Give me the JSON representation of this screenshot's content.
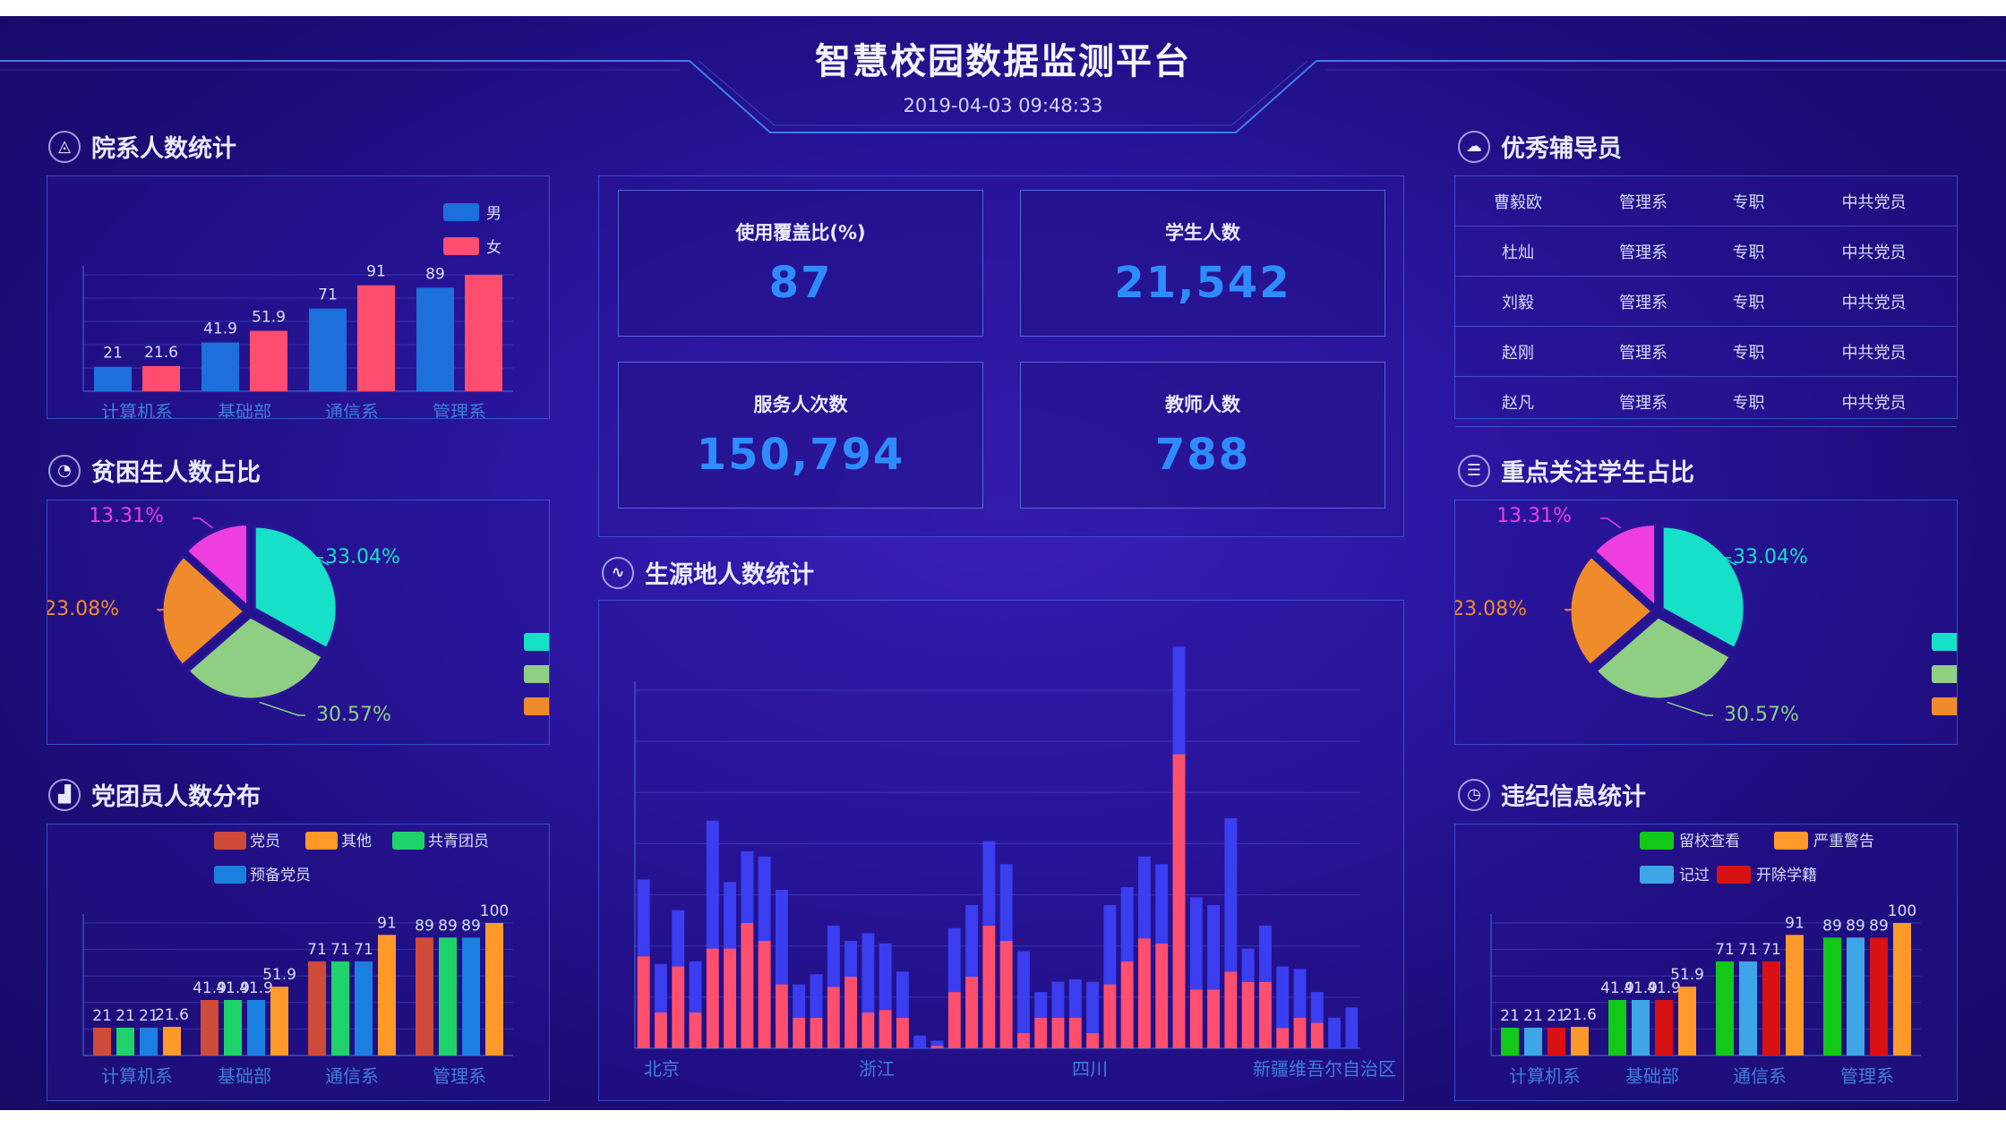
{
  "header": {
    "title": "智慧校园数据监测平台",
    "datetime": "2019-04-03 09:48:33"
  },
  "sections": {
    "dept_count": "院系人数统计",
    "poverty_ratio": "贫困生人数占比",
    "party_distribution": "党团员人数分布",
    "origin_stats": "生源地人数统计",
    "tutors": "优秀辅导员",
    "focus_ratio": "重点关注学生占比",
    "discipline": "违纪信息统计"
  },
  "stats": [
    {
      "label": "使用覆盖比(%)",
      "value": "87"
    },
    {
      "label": "学生人数",
      "value": "21,542"
    },
    {
      "label": "服务人次数",
      "value": "150,794"
    },
    {
      "label": "教师人数",
      "value": "788"
    }
  ],
  "tutors": [
    [
      "曹毅欧",
      "管理系",
      "专职",
      "中共党员"
    ],
    [
      "杜灿",
      "管理系",
      "专职",
      "中共党员"
    ],
    [
      "刘毅",
      "管理系",
      "专职",
      "中共党员"
    ],
    [
      "赵刚",
      "管理系",
      "专职",
      "中共党员"
    ],
    [
      "赵凡",
      "管理系",
      "专职",
      "中共党员"
    ]
  ],
  "colors": {
    "blue_bar": "#1d6fdc",
    "pink_bar": "#ff4d6d",
    "cyan": "#16e0c7",
    "green": "#8ecf84",
    "orange": "#f08b2c",
    "magenta": "#ee3ee0",
    "party_red": "#d04a3a",
    "party_orange": "#ff9a2a",
    "party_green": "#1fd36b",
    "party_blue": "#1a7fe0",
    "disc_green": "#12c91a",
    "disc_orange": "#ff9a2a",
    "disc_lightblue": "#3ea6e6",
    "disc_red": "#d81212",
    "origin_blue": "#3a3ef0",
    "origin_pink": "#ff4f6e"
  },
  "chart_data": [
    {
      "id": "dept_count",
      "type": "bar",
      "categories": [
        "计算机系",
        "基础部",
        "通信系",
        "管理系"
      ],
      "series": [
        {
          "name": "男",
          "values": [
            21,
            41.9,
            71,
            89
          ]
        },
        {
          "name": "女",
          "values": [
            21.6,
            51.9,
            91,
            100
          ]
        }
      ],
      "data_labels": [
        "21",
        "21.6",
        "41.9",
        "51.9",
        "71",
        "91",
        "89"
      ],
      "ylim": [
        0,
        100
      ]
    },
    {
      "id": "poverty_ratio",
      "type": "pie",
      "slices": [
        {
          "value": 33.04,
          "label": "33.04%"
        },
        {
          "value": 30.57,
          "label": "30.57%"
        },
        {
          "value": 23.08,
          "label": "23.08%"
        },
        {
          "value": 13.31,
          "label": "13.31%"
        }
      ]
    },
    {
      "id": "party_distribution",
      "type": "bar",
      "categories": [
        "计算机系",
        "基础部",
        "通信系",
        "管理系"
      ],
      "series": [
        {
          "name": "党员",
          "values": [
            21,
            41.9,
            71,
            89
          ]
        },
        {
          "name": "共青团员",
          "values": [
            21,
            41.9,
            71,
            89
          ]
        },
        {
          "name": "预备党员",
          "values": [
            21,
            41.9,
            71,
            89
          ]
        },
        {
          "name": "其他",
          "values": [
            21.6,
            51.9,
            91,
            100
          ]
        }
      ],
      "legend_order": [
        "党员",
        "其他",
        "共青团员",
        "预备党员"
      ],
      "data_labels": [
        [
          "21",
          "21",
          "21",
          "21.6"
        ],
        [
          "41.9",
          "41.9",
          "41.9",
          "51.9"
        ],
        [
          "71",
          "71",
          "71",
          "91"
        ],
        [
          "89",
          "89",
          "89",
          "100"
        ]
      ],
      "ylim": [
        0,
        100
      ]
    },
    {
      "id": "origin_stats",
      "type": "bar",
      "stacked": true,
      "x_ticks": [
        "北京",
        "浙江",
        "四川",
        "新疆维吾尔自治区"
      ],
      "series": [
        {
          "values": [
            30,
            19,
            22,
            20,
            50,
            26,
            28,
            33,
            37,
            13,
            17,
            24,
            14,
            31,
            26,
            18,
            5,
            2,
            25,
            28,
            33,
            30,
            32,
            10,
            14,
            15,
            20,
            31,
            29,
            32,
            31,
            42,
            36,
            33,
            60,
            13,
            22,
            24,
            19,
            12,
            12,
            16
          ]
        },
        {
          "values": [
            36,
            14,
            32,
            14,
            39,
            39,
            49,
            42,
            25,
            12,
            12,
            24,
            28,
            14,
            15,
            12,
            0,
            1,
            22,
            28,
            48,
            42,
            6,
            12,
            12,
            12,
            6,
            25,
            34,
            43,
            41,
            115,
            23,
            23,
            30,
            26,
            26,
            8,
            12,
            10
          ]
        }
      ],
      "ylim": [
        0,
        140
      ]
    },
    {
      "id": "focus_ratio",
      "type": "pie",
      "slices": [
        {
          "value": 33.04,
          "label": "33.04%"
        },
        {
          "value": 30.57,
          "label": "30.57%"
        },
        {
          "value": 23.08,
          "label": "23.08%"
        },
        {
          "value": 13.31,
          "label": "13.31%"
        }
      ]
    },
    {
      "id": "discipline",
      "type": "bar",
      "categories": [
        "计算机系",
        "基础部",
        "通信系",
        "管理系"
      ],
      "series": [
        {
          "name": "留校查看",
          "values": [
            21,
            41.9,
            71,
            89
          ]
        },
        {
          "name": "记过",
          "values": [
            21,
            41.9,
            71,
            89
          ]
        },
        {
          "name": "开除学籍",
          "values": [
            21,
            41.9,
            71,
            89
          ]
        },
        {
          "name": "严重警告",
          "values": [
            21.6,
            51.9,
            91,
            100
          ]
        }
      ],
      "legend_order": [
        "留校查看",
        "严重警告",
        "记过",
        "开除学籍"
      ],
      "data_labels": [
        [
          "21",
          "21",
          "21",
          "21.6"
        ],
        [
          "41.9",
          "41.9",
          "41.9",
          "51.9"
        ],
        [
          "71",
          "71",
          "71",
          "91"
        ],
        [
          "89",
          "89",
          "89",
          "100"
        ]
      ],
      "ylim": [
        0,
        100
      ]
    }
  ]
}
